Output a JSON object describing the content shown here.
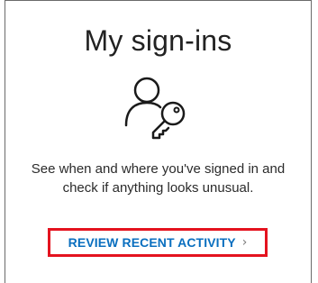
{
  "card": {
    "title": "My sign-ins",
    "icon": "user-key-icon",
    "description_line1": "See when and where you've signed in and",
    "description_line2": "check if anything looks unusual.",
    "link_label": "REVIEW RECENT ACTIVITY",
    "link_chevron": "›"
  },
  "colors": {
    "highlight_border": "#e4131f",
    "link": "#0a6fbf",
    "text": "#2b2b2b"
  }
}
